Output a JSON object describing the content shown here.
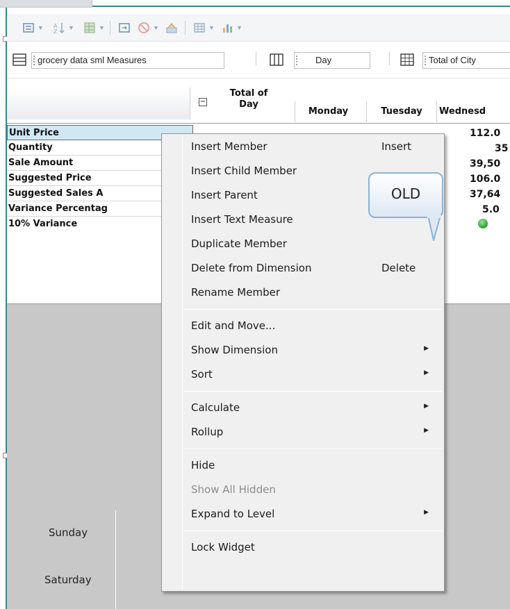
{
  "toolbar": {
    "buttons": [
      {
        "icon": "measure-dropdown-icon",
        "dropdown": true
      },
      {
        "icon": "sort-icon",
        "dropdown": true
      },
      {
        "icon": "calculation-icon",
        "dropdown": true
      },
      {
        "icon": "swap-axes-icon",
        "dropdown": false
      },
      {
        "icon": "cancel-filter-icon",
        "dropdown": true
      },
      {
        "icon": "format-icon",
        "dropdown": false
      },
      {
        "icon": "table-view-icon",
        "dropdown": true
      },
      {
        "icon": "chart-view-icon",
        "dropdown": true
      }
    ]
  },
  "shelf": {
    "measures_label": "grocery data sml Measures",
    "columns_label": "Day",
    "rows_label": "Total of City"
  },
  "table": {
    "columns": {
      "total": "Total of Day",
      "monday": "Monday",
      "tuesday": "Tuesday",
      "wednesday": "Wednesd"
    },
    "rows": [
      {
        "label": "Unit Price",
        "wednesday": "112.0",
        "selected": true
      },
      {
        "label": "Quantity",
        "wednesday": "35"
      },
      {
        "label": "Sale Amount",
        "wednesday": "39,50"
      },
      {
        "label": "Suggested Price",
        "wednesday": "106.0"
      },
      {
        "label": "Suggested Sales A",
        "wednesday": "37,64"
      },
      {
        "label": "Variance Percentag",
        "wednesday": "5.0"
      },
      {
        "label": "10% Variance",
        "wednesday": "",
        "indicator": "green"
      }
    ]
  },
  "chart_pane": {
    "labels": [
      "Sunday",
      "Saturday"
    ]
  },
  "context_menu": {
    "items": [
      {
        "label": "Insert Member",
        "shortcut": "Insert"
      },
      {
        "label": "Insert Child Member"
      },
      {
        "label": "Insert Parent"
      },
      {
        "label": "Insert Text Measure"
      },
      {
        "label": "Duplicate Member"
      },
      {
        "label": "Delete from Dimension",
        "shortcut": "Delete"
      },
      {
        "label": "Rename Member"
      },
      {
        "label": "Edit and Move..."
      },
      {
        "label": "Show Dimension",
        "submenu": true
      },
      {
        "label": "Sort",
        "submenu": true
      },
      {
        "label": "Calculate",
        "submenu": true
      },
      {
        "label": "Rollup",
        "submenu": true
      },
      {
        "label": "Hide"
      },
      {
        "label": "Show All Hidden",
        "disabled": true
      },
      {
        "label": "Expand to Level",
        "submenu": true
      },
      {
        "label": "Lock Widget"
      }
    ]
  },
  "callout": {
    "text": "OLD"
  },
  "colors": {
    "frame": "#2f8a93",
    "selection": "#cfe8f3",
    "indicator": "#3aa83a",
    "pane": "#c8c8c8"
  }
}
